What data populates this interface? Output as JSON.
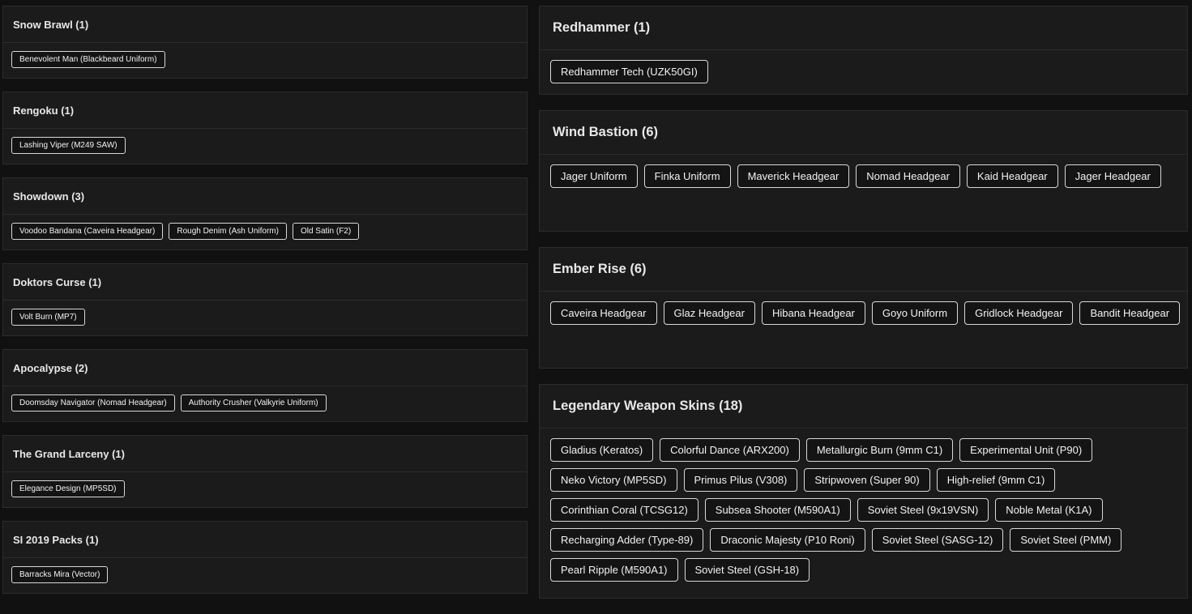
{
  "left_sections": [
    {
      "title": "Snow Brawl (1)",
      "items": [
        "Benevolent Man (Blackbeard Uniform)"
      ]
    },
    {
      "title": "Rengoku (1)",
      "items": [
        "Lashing Viper (M249 SAW)"
      ]
    },
    {
      "title": "Showdown (3)",
      "items": [
        "Voodoo Bandana (Caveira Headgear)",
        "Rough Denim (Ash Uniform)",
        "Old Satin (F2)"
      ]
    },
    {
      "title": "Doktors Curse (1)",
      "items": [
        "Volt Burn (MP7)"
      ]
    },
    {
      "title": "Apocalypse (2)",
      "items": [
        "Doomsday Navigator (Nomad Headgear)",
        "Authority Crusher (Valkyrie Uniform)"
      ]
    },
    {
      "title": "The Grand Larceny (1)",
      "items": [
        "Elegance Design (MP5SD)"
      ]
    },
    {
      "title": "SI 2019 Packs (1)",
      "items": [
        "Barracks Mira (Vector)"
      ]
    }
  ],
  "right_sections": [
    {
      "title": "Redhammer (1)",
      "items": [
        "Redhammer Tech (UZK50GI)"
      ]
    },
    {
      "title": "Wind Bastion (6)",
      "items": [
        "Jager Uniform",
        "Finka Uniform",
        "Maverick Headgear",
        "Nomad Headgear",
        "Kaid Headgear",
        "Jager Headgear"
      ]
    },
    {
      "title": "Ember Rise (6)",
      "items": [
        "Caveira Headgear",
        "Glaz Headgear",
        "Hibana Headgear",
        "Goyo Uniform",
        "Gridlock Headgear",
        "Bandit Headgear"
      ]
    },
    {
      "title": "Legendary Weapon Skins (18)",
      "items": [
        "Gladius (Keratos)",
        "Colorful Dance (ARX200)",
        "Metallurgic Burn (9mm C1)",
        "Experimental Unit (P90)",
        "Neko Victory (MP5SD)",
        "Primus Pilus (V308)",
        "Stripwoven (Super 90)",
        "High-relief (9mm C1)",
        "Corinthian Coral (TCSG12)",
        "Subsea Shooter (M590A1)",
        "Soviet Steel (9x19VSN)",
        "Noble Metal (K1A)",
        "Recharging Adder (Type-89)",
        "Draconic Majesty (P10 Roni)",
        "Soviet Steel (SASG-12)",
        "Soviet Steel (PMM)",
        "Pearl Ripple (M590A1)",
        "Soviet Steel (GSH-18)"
      ]
    }
  ],
  "colors": {
    "background": "#111111",
    "card": "#1b1b1b",
    "border": "#2c2c2c",
    "tag_border": "#d8d8d8",
    "text": "#e8e8e8"
  }
}
